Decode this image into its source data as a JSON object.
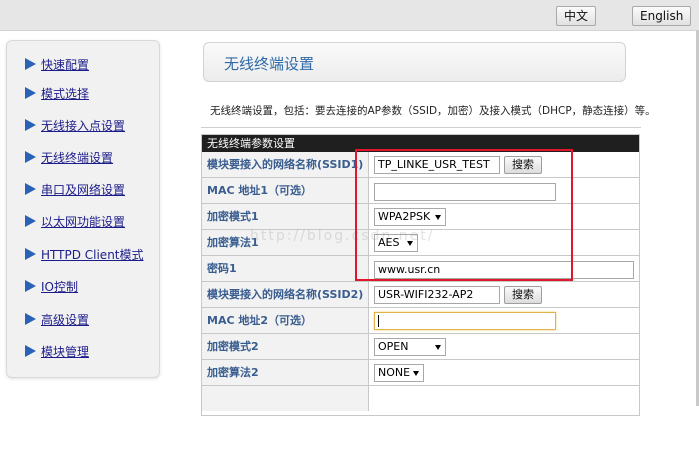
{
  "topbar": {
    "lang_zh": "中文",
    "lang_en": "English"
  },
  "sidebar": {
    "items": [
      {
        "label": "快速配置"
      },
      {
        "label": "模式选择"
      },
      {
        "label": "无线接入点设置"
      },
      {
        "label": "无线终端设置"
      },
      {
        "label": "串口及网络设置"
      },
      {
        "label": "以太网功能设置"
      },
      {
        "label": "HTTPD Client模式"
      },
      {
        "label": "IO控制"
      },
      {
        "label": "高级设置"
      },
      {
        "label": "模块管理"
      }
    ]
  },
  "page": {
    "title": "无线终端设置",
    "description": "无线终端设置，包括：要去连接的AP参数（SSID，加密）及接入模式（DHCP，静态连接）等。"
  },
  "panel": {
    "header": "无线终端参数设置",
    "search_label": "搜索",
    "rows": [
      {
        "label": "模块要接入的网络名称(SSID1)",
        "value": "TP_LINKE_USR_TEST"
      },
      {
        "label": "MAC 地址1（可选）",
        "value": ""
      },
      {
        "label": "加密模式1",
        "value": "WPA2PSK"
      },
      {
        "label": "加密算法1",
        "value": "AES"
      },
      {
        "label": "密码1",
        "value": "www.usr.cn"
      },
      {
        "label": "模块要接入的网络名称(SSID2)",
        "value": "USR-WIFI232-AP2"
      },
      {
        "label": "MAC 地址2（可选）",
        "value": ""
      },
      {
        "label": "加密模式2",
        "value": "OPEN"
      },
      {
        "label": "加密算法2",
        "value": "NONE"
      }
    ]
  },
  "watermark": "http://blog.csdn.net/",
  "colors": {
    "accent": "#2f6aa8",
    "highlight": "#e0162b",
    "panel_header": "#1f1f1f"
  }
}
